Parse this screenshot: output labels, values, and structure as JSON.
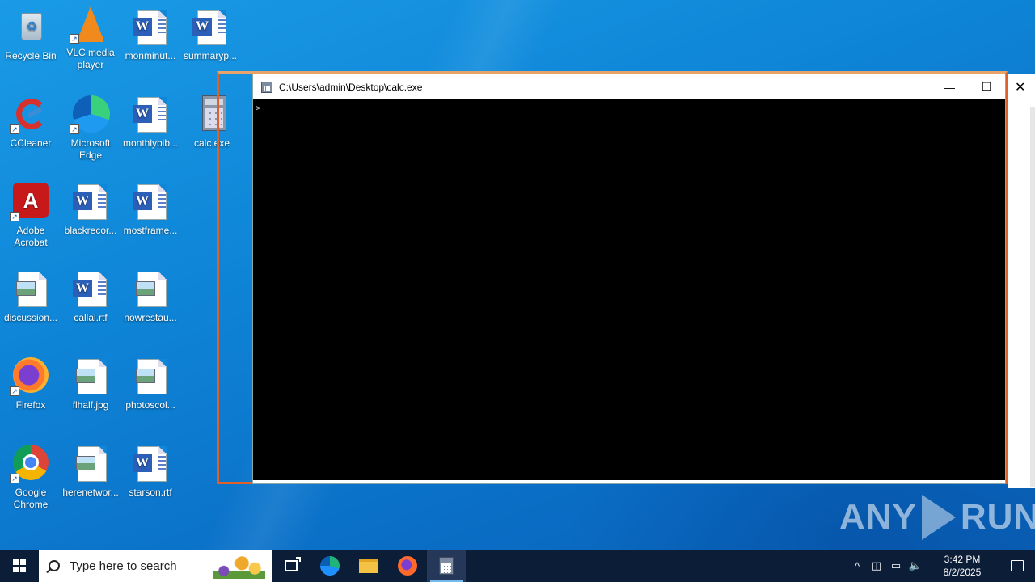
{
  "desktop": {
    "icons": [
      {
        "label": "Recycle Bin",
        "icon": "recycle-bin-icon"
      },
      {
        "label": "VLC media player",
        "icon": "vlc-icon"
      },
      {
        "label": "monminut...",
        "icon": "word-doc-icon"
      },
      {
        "label": "summaryp...",
        "icon": "word-doc-icon"
      },
      {
        "label": "CCleaner",
        "icon": "ccleaner-icon"
      },
      {
        "label": "Microsoft Edge",
        "icon": "edge-icon"
      },
      {
        "label": "monthlybib...",
        "icon": "word-doc-icon"
      },
      {
        "label": "calc.exe",
        "icon": "calculator-icon"
      },
      {
        "label": "Adobe Acrobat",
        "icon": "acrobat-icon"
      },
      {
        "label": "blackrecor...",
        "icon": "word-doc-icon"
      },
      {
        "label": "mostframe...",
        "icon": "word-doc-icon"
      },
      {
        "label": "discussion...",
        "icon": "image-file-icon"
      },
      {
        "label": "callal.rtf",
        "icon": "word-doc-icon"
      },
      {
        "label": "nowrestau...",
        "icon": "image-file-icon"
      },
      {
        "label": "Firefox",
        "icon": "firefox-icon"
      },
      {
        "label": "flhalf.jpg",
        "icon": "image-file-icon"
      },
      {
        "label": "photoscol...",
        "icon": "image-file-icon"
      },
      {
        "label": "Google Chrome",
        "icon": "chrome-icon"
      },
      {
        "label": "herenetwor...",
        "icon": "image-file-icon"
      },
      {
        "label": "starson.rtf",
        "icon": "word-doc-icon"
      }
    ]
  },
  "console": {
    "title": "C:\\Users\\admin\\Desktop\\calc.exe",
    "prompt": ">",
    "minimize": "—",
    "maximize": "☐",
    "close": "✕"
  },
  "edge_window": {
    "close": "✕"
  },
  "watermark": {
    "left": "ANY",
    "right": "RUN"
  },
  "taskbar": {
    "search_placeholder": "Type here to search",
    "time": "3:42 PM",
    "date": "8/2/2025",
    "tray_chevron": "^"
  },
  "colors": {
    "desktop_blue": "#0f86d8",
    "taskbar": "#0c1d38",
    "selection_frame": "#e0602a"
  }
}
